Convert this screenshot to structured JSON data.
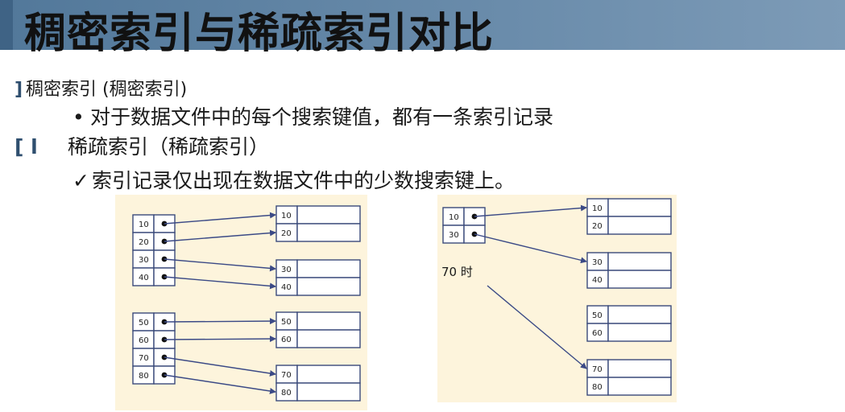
{
  "slide": {
    "title": "稠密索引与稀疏索引对比",
    "bullets": [
      {
        "marker": "]",
        "text": "稠密索引 (稠密索引)",
        "sub": {
          "marker": "•",
          "text": "对于数据文件中的每个搜索键值，都有一条索引记录"
        }
      },
      {
        "marker": "[ l",
        "text": "稀疏索引（稀疏索引）",
        "sub": {
          "marker": "✓",
          "text": "索引记录仅出现在数据文件中的少数搜索键上。"
        }
      }
    ]
  },
  "dense_diagram": {
    "index_groups": [
      [
        "10",
        "20",
        "30",
        "40"
      ],
      [
        "50",
        "60",
        "70",
        "80"
      ]
    ],
    "record_blocks": [
      [
        "10",
        "20"
      ],
      [
        "30",
        "40"
      ],
      [
        "50",
        "60"
      ],
      [
        "70",
        "80"
      ]
    ]
  },
  "sparse_diagram": {
    "index_keys": [
      "10",
      "30"
    ],
    "note": "70 时",
    "record_blocks": [
      [
        "10",
        "20"
      ],
      [
        "30",
        "40"
      ],
      [
        "50",
        "60"
      ],
      [
        "70",
        "80"
      ]
    ]
  },
  "colors": {
    "header_bar": "#6a8cab",
    "diagram_bg": "#fdf4dc",
    "cell_border": "#3a4a7a",
    "arrow": "#3b4a86"
  }
}
